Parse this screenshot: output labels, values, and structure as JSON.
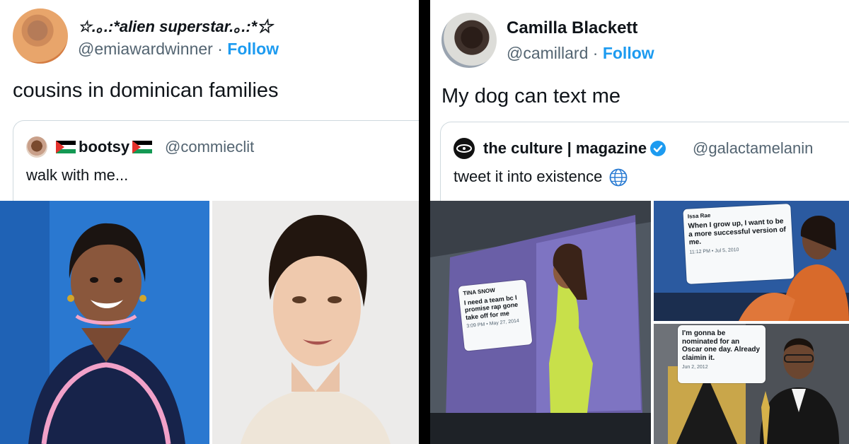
{
  "left_tweet": {
    "display_name": "☆.｡.:*alien superstar.｡.:*☆",
    "handle": "@emiawardwinner",
    "separator": "·",
    "follow_label": "Follow",
    "text": "cousins in dominican families",
    "quote": {
      "name": "bootsy",
      "handle": "@commieclit",
      "text": "walk with me..."
    }
  },
  "right_tweet": {
    "display_name": "Camilla Blackett",
    "handle": "@camillard",
    "separator": "·",
    "follow_label": "Follow",
    "text": "My dog can text me",
    "quote": {
      "name": "the culture | magazine",
      "handle": "@galactamelanin",
      "text": "tweet it into existence"
    },
    "billboards": [
      {
        "name": "TINA SNOW",
        "text": "I need a team bc I promise rap gone take off for me",
        "date": "3:09 PM • May 27, 2014"
      },
      {
        "name": "Issa Rae",
        "text": "When I grow up, I want to be a more successful version of me.",
        "date": "11:12 PM • Jul 5, 2010"
      },
      {
        "name": "",
        "text": "I'm gonna be nominated for an Oscar one day. Already claimin it.",
        "date": "Jun 2, 2012"
      }
    ]
  },
  "colors": {
    "accent": "#1d9bf0",
    "verified": "#1d9bf0",
    "secondary_text": "#536471"
  }
}
